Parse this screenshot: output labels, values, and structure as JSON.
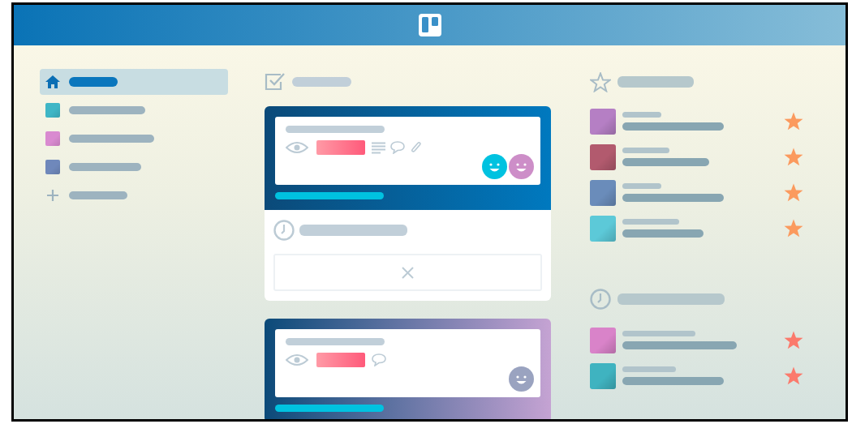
{
  "sidebar": {
    "items": [
      {
        "kind": "home",
        "selected": true
      },
      {
        "kind": "board",
        "color": "#3fb6c6",
        "selected": false
      },
      {
        "kind": "board",
        "color": "#d98ad0",
        "selected": false
      },
      {
        "kind": "board",
        "color": "#6f88bb",
        "selected": false
      },
      {
        "kind": "add",
        "selected": false
      }
    ]
  },
  "cards": [
    {
      "color": "#0079bf",
      "badges": [
        {
          "kind": "watch"
        },
        {
          "kind": "description"
        },
        {
          "kind": "comment"
        },
        {
          "kind": "attachment"
        }
      ],
      "members": [
        {
          "color": "#00c2e0"
        },
        {
          "color": "#cd8ec8"
        }
      ],
      "expanded": true
    },
    {
      "color": "#c5a3d3",
      "badges": [
        {
          "kind": "watch"
        },
        {
          "kind": "comment"
        }
      ],
      "members": [
        {
          "color": "#9aa3c0"
        }
      ],
      "expanded": false
    }
  ],
  "starred": {
    "items": [
      {
        "color": "#b57fc4",
        "starred": true
      },
      {
        "color": "#b25a6e",
        "starred": true
      },
      {
        "color": "#6a8cba",
        "starred": true
      },
      {
        "color": "#5cc9d8",
        "starred": true
      }
    ]
  },
  "recent": {
    "items": [
      {
        "color": "#d983c9",
        "starred": true
      },
      {
        "color": "#3fb3c0",
        "starred": true
      }
    ]
  }
}
